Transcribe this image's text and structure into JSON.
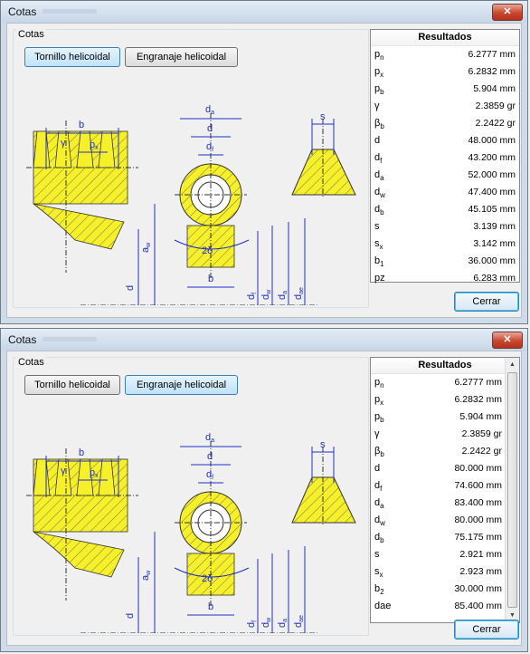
{
  "windows": [
    {
      "title": "Cotas",
      "group_label": "Cotas",
      "tab_worm": "Tornillo helicoidal",
      "tab_gear": "Engranaje helicoidal",
      "results_title": "Resultados",
      "close_label": "Cerrar",
      "results": [
        {
          "label": "p",
          "sub": "n",
          "value": "6.2777 mm"
        },
        {
          "label": "p",
          "sub": "x",
          "value": "6.2832 mm"
        },
        {
          "label": "p",
          "sub": "b",
          "value": "5.904 mm"
        },
        {
          "label": "γ",
          "sub": "",
          "value": "2.3859 gr"
        },
        {
          "label": "β",
          "sub": "b",
          "value": "2.2422 gr"
        },
        {
          "label": "d",
          "sub": "",
          "value": "48.000 mm"
        },
        {
          "label": "d",
          "sub": "f",
          "value": "43.200 mm"
        },
        {
          "label": "d",
          "sub": "a",
          "value": "52.000 mm"
        },
        {
          "label": "d",
          "sub": "w",
          "value": "47.400 mm"
        },
        {
          "label": "d",
          "sub": "b",
          "value": "45.105 mm"
        },
        {
          "label": "s",
          "sub": "",
          "value": "3.139 mm"
        },
        {
          "label": "s",
          "sub": "x",
          "value": "3.142 mm"
        },
        {
          "label": "b",
          "sub": "1",
          "value": "36.000 mm"
        },
        {
          "label": "pz",
          "sub": "",
          "value": "6.283 mm"
        }
      ]
    },
    {
      "title": "Cotas",
      "group_label": "Cotas",
      "tab_worm": "Tornillo helicoidal",
      "tab_gear": "Engranaje helicoidal",
      "results_title": "Resultados",
      "close_label": "Cerrar",
      "results": [
        {
          "label": "p",
          "sub": "n",
          "value": "6.2777 mm"
        },
        {
          "label": "p",
          "sub": "x",
          "value": "6.2832 mm"
        },
        {
          "label": "p",
          "sub": "b",
          "value": "5.904 mm"
        },
        {
          "label": "γ",
          "sub": "",
          "value": "2.3859 gr"
        },
        {
          "label": "β",
          "sub": "b",
          "value": "2.2422 gr"
        },
        {
          "label": "d",
          "sub": "",
          "value": "80.000 mm"
        },
        {
          "label": "d",
          "sub": "f",
          "value": "74.600 mm"
        },
        {
          "label": "d",
          "sub": "a",
          "value": "83.400 mm"
        },
        {
          "label": "d",
          "sub": "w",
          "value": "80.000 mm"
        },
        {
          "label": "d",
          "sub": "b",
          "value": "75.175 mm"
        },
        {
          "label": "s",
          "sub": "",
          "value": "2.921 mm"
        },
        {
          "label": "s",
          "sub": "x",
          "value": "2.923 mm"
        },
        {
          "label": "b",
          "sub": "2",
          "value": "30.000 mm"
        },
        {
          "label": "dae",
          "sub": "",
          "value": "85.400 mm"
        }
      ]
    }
  ],
  "diagram_labels": {
    "b": "b",
    "gamma": "γ",
    "px": "p",
    "px_sub": "x",
    "da": "d",
    "da_sub": "a",
    "d": "d",
    "df": "d",
    "df_sub": "f",
    "s": "s",
    "two_delta": "2δ",
    "aw": "a",
    "aw_sub": "w",
    "dw_sub": "w",
    "dae_sub": "ae"
  },
  "colors": {
    "gear_fill": "#f6f02a",
    "dimension_blue": "#1f2fc8",
    "selected_tab": "#bfe2f7",
    "close_button": "#c9472d"
  }
}
